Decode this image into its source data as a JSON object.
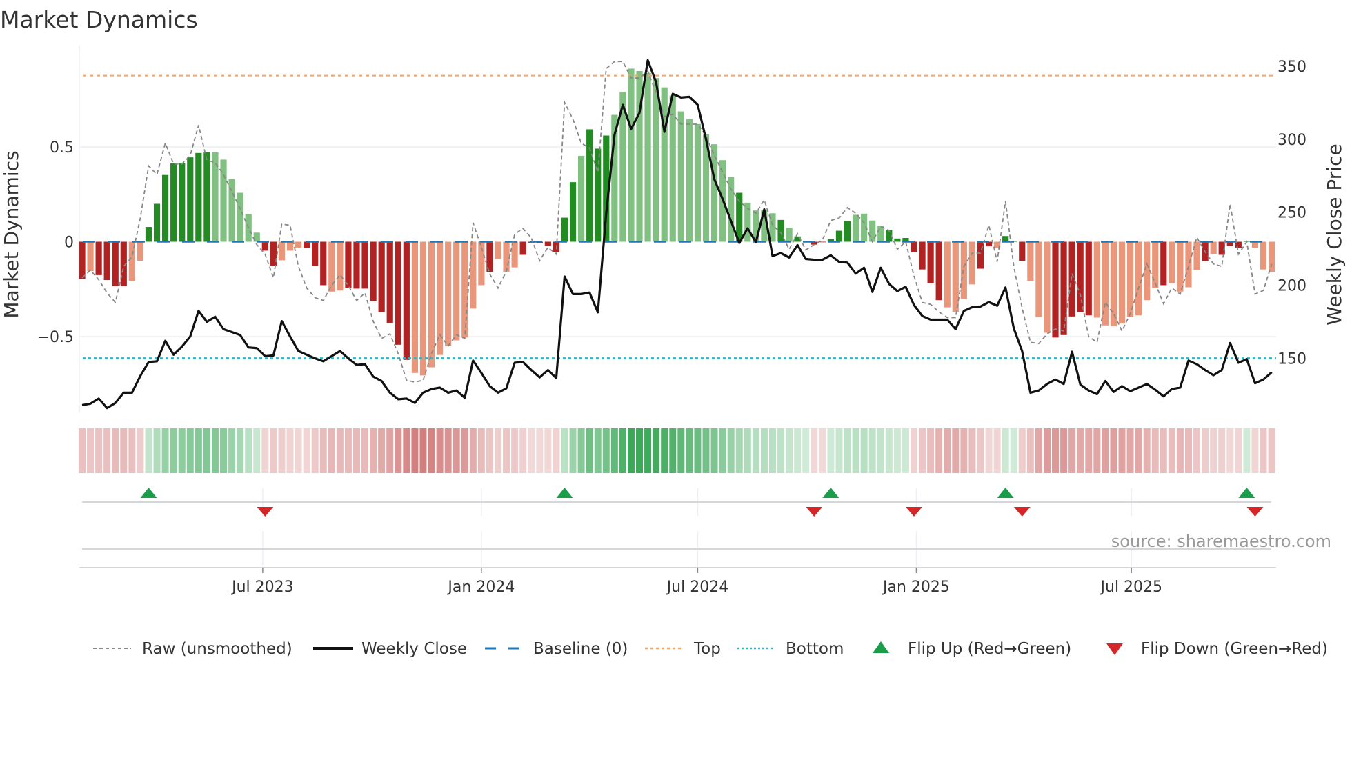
{
  "title": "Market Dynamics",
  "source": "source: sharemaestro.com",
  "chart_data": {
    "type": "bar",
    "title": "Market Dynamics",
    "frequency": "weekly",
    "start_date": "2023-01-30",
    "ylabel_left": "Market Dynamics",
    "ylabel_right": "Weekly Close Price",
    "ylim_left": [
      -0.9,
      0.98
    ],
    "ylim_right": [
      113,
      357
    ],
    "yticks_left": [
      {
        "v": 0.5,
        "label": "0.5"
      },
      {
        "v": 0,
        "label": "0"
      },
      {
        "v": -0.5,
        "label": "−0.5"
      }
    ],
    "yticks_right": [
      {
        "v": 350,
        "label": "350"
      },
      {
        "v": 300,
        "label": "300"
      },
      {
        "v": 250,
        "label": "250"
      },
      {
        "v": 200,
        "label": "200"
      },
      {
        "v": 150,
        "label": "150"
      }
    ],
    "xticks": [
      {
        "date": "2023-07-01",
        "label": "Jul 2023"
      },
      {
        "date": "2024-01-01",
        "label": "Jan 2024"
      },
      {
        "date": "2024-07-01",
        "label": "Jul 2024"
      },
      {
        "date": "2025-01-01",
        "label": "Jan 2025"
      },
      {
        "date": "2025-07-01",
        "label": "Jul 2025"
      }
    ],
    "thresholds": {
      "top": 0.876,
      "bottom": -0.614,
      "baseline": 0
    },
    "colors": {
      "green_dark": "#228b22",
      "green_light": "#80c080",
      "red_dark": "#b22222",
      "red_light": "#e9967a",
      "raw": "#888888",
      "close": "#111111",
      "baseline": "#1f77b4",
      "top": "#f4a460",
      "bottom": "#17becf",
      "flip_up": "#1a9e4a",
      "flip_down": "#d62728"
    },
    "momentum": [
      -0.196,
      -0.155,
      -0.176,
      -0.202,
      -0.234,
      -0.234,
      -0.206,
      -0.1,
      0.078,
      0.2,
      0.352,
      0.413,
      0.416,
      0.445,
      0.468,
      0.472,
      0.471,
      0.433,
      0.331,
      0.258,
      0.146,
      0.048,
      -0.047,
      -0.127,
      -0.098,
      -0.047,
      -0.032,
      -0.034,
      -0.127,
      -0.229,
      -0.263,
      -0.257,
      -0.242,
      -0.247,
      -0.247,
      -0.313,
      -0.371,
      -0.429,
      -0.543,
      -0.623,
      -0.692,
      -0.705,
      -0.662,
      -0.597,
      -0.55,
      -0.52,
      -0.505,
      -0.352,
      -0.229,
      -0.159,
      -0.092,
      -0.158,
      -0.135,
      -0.069,
      -0.005,
      -0.006,
      -0.022,
      -0.056,
      0.127,
      0.314,
      0.453,
      0.593,
      0.491,
      0.56,
      0.669,
      0.789,
      0.913,
      0.9,
      0.89,
      0.863,
      0.814,
      0.771,
      0.687,
      0.646,
      0.621,
      0.566,
      0.514,
      0.43,
      0.341,
      0.258,
      0.206,
      0.165,
      0.168,
      0.15,
      0.115,
      0.074,
      0.028,
      0.002,
      -0.015,
      -0.003,
      0.013,
      0.058,
      0.109,
      0.142,
      0.148,
      0.112,
      0.084,
      0.061,
      0.017,
      0.02,
      -0.053,
      -0.146,
      -0.219,
      -0.308,
      -0.346,
      -0.369,
      -0.302,
      -0.225,
      -0.142,
      -0.024,
      -0.032,
      0.03,
      0.003,
      -0.1,
      -0.206,
      -0.397,
      -0.48,
      -0.505,
      -0.492,
      -0.394,
      -0.371,
      -0.388,
      -0.4,
      -0.441,
      -0.445,
      -0.431,
      -0.397,
      -0.388,
      -0.308,
      -0.244,
      -0.229,
      -0.219,
      -0.263,
      -0.24,
      -0.149,
      -0.102,
      -0.064,
      -0.069,
      -0.022,
      -0.031,
      0.003,
      -0.031,
      -0.146,
      -0.159
    ],
    "shade": "dlddddlldddddddd llllllddllldddllddddddddllllllllldllldddddddldddllllllllllllllldlllldldldddddlllldddddddllllddldddllldddddlllllllldlllldldddd",
    "raw": [
      -0.19,
      -0.15,
      -0.2,
      -0.27,
      -0.32,
      -0.13,
      -0.08,
      0.125,
      0.4,
      0.354,
      0.52,
      0.41,
      0.41,
      0.455,
      0.615,
      0.43,
      0.417,
      0.354,
      0.265,
      0.175,
      0.074,
      -0.015,
      -0.066,
      -0.19,
      0.093,
      0.087,
      -0.13,
      -0.244,
      -0.295,
      -0.31,
      -0.23,
      -0.174,
      -0.23,
      -0.31,
      -0.27,
      -0.42,
      -0.51,
      -0.486,
      -0.59,
      -0.73,
      -0.74,
      -0.73,
      -0.59,
      -0.49,
      -0.55,
      -0.49,
      -0.51,
      0.1,
      -0.03,
      -0.17,
      -0.244,
      -0.155,
      0.04,
      0.07,
      0.02,
      -0.1,
      -0.03,
      -0.066,
      0.735,
      0.646,
      0.52,
      0.494,
      0.366,
      0.913,
      0.95,
      0.95,
      0.863,
      0.863,
      0.9,
      0.786,
      0.66,
      0.672,
      0.62,
      0.62,
      0.62,
      0.557,
      0.455,
      0.366,
      0.277,
      0.214,
      0.176,
      0.15,
      0.22,
      0.087,
      0.048,
      -0.04,
      0.042,
      -0.043,
      -0.015,
      0.01,
      0.112,
      0.125,
      0.18,
      0.15,
      0.1,
      0,
      0.08,
      0.06,
      -0.04,
      0,
      -0.18,
      -0.32,
      -0.33,
      -0.37,
      -0.4,
      -0.4,
      -0.13,
      -0.06,
      -0.06,
      0.087,
      -0.105,
      0.214,
      -0.13,
      -0.35,
      -0.53,
      -0.537,
      -0.486,
      -0.46,
      -0.47,
      -0.168,
      -0.28,
      -0.5,
      -0.53,
      -0.32,
      -0.38,
      -0.47,
      -0.38,
      -0.244,
      -0.117,
      -0.219,
      -0.327,
      -0.244,
      -0.276,
      -0.13,
      0.023,
      -0.053,
      -0.117,
      -0.13,
      0.2,
      -0.066,
      0,
      -0.276,
      -0.257,
      -0.117
    ],
    "close": [
      118,
      119,
      122.5,
      116,
      119.5,
      126.5,
      126.5,
      138,
      147.5,
      148,
      162,
      152.5,
      158,
      165,
      182.5,
      175,
      178.5,
      170,
      168,
      166,
      157.5,
      157,
      151.5,
      152,
      175.5,
      165,
      155,
      152.5,
      150,
      148,
      151.5,
      155,
      150,
      145.5,
      146,
      137.5,
      134.5,
      126.5,
      122,
      122.5,
      119.5,
      126.5,
      129,
      130,
      126.5,
      128,
      123,
      148.5,
      140,
      131,
      126.5,
      129.5,
      147,
      147.5,
      142,
      137,
      142,
      136.5,
      206,
      194,
      194,
      195,
      181.5,
      249,
      303,
      323.5,
      307,
      318,
      354,
      339,
      305,
      331,
      328.5,
      329,
      323.5,
      300,
      272.5,
      259,
      244,
      229,
      239,
      229.5,
      252,
      220,
      222,
      219,
      227.5,
      218,
      217.5,
      217.5,
      220.5,
      216,
      215.5,
      208,
      212,
      195.5,
      212,
      201,
      196,
      199,
      186.5,
      179,
      176.5,
      176.5,
      176.5,
      170,
      182.5,
      185,
      185.5,
      188.5,
      186,
      198.5,
      170.5,
      155,
      126.5,
      128,
      132.5,
      135.5,
      132.5,
      154.5,
      132,
      128,
      125.5,
      134.5,
      127,
      131,
      127.5,
      130,
      132.5,
      128.5,
      124,
      129,
      130,
      148.5,
      146,
      142,
      138.5,
      142,
      160.5,
      147,
      149.5,
      133,
      135.5,
      140.5
    ],
    "flips": [
      {
        "index": 9,
        "dir": "up"
      },
      {
        "index": 23,
        "dir": "down"
      },
      {
        "index": 59,
        "dir": "up"
      },
      {
        "index": 89,
        "dir": "down"
      },
      {
        "index": 91,
        "dir": "up"
      },
      {
        "index": 101,
        "dir": "down"
      },
      {
        "index": 112,
        "dir": "up"
      },
      {
        "index": 114,
        "dir": "down"
      },
      {
        "index": 141,
        "dir": "up"
      },
      {
        "index": 142,
        "dir": "down"
      }
    ],
    "legend": {
      "position": "bottom",
      "items": [
        {
          "key": "raw",
          "label": "Raw (unsmoothed)"
        },
        {
          "key": "close",
          "label": "Weekly Close"
        },
        {
          "key": "baseline",
          "label": "Baseline (0)"
        },
        {
          "key": "top",
          "label": "Top"
        },
        {
          "key": "bottom",
          "label": "Bottom"
        },
        {
          "key": "flip_up",
          "label": "Flip Up (Red→Green)"
        },
        {
          "key": "flip_down",
          "label": "Flip Down (Green→Red)"
        }
      ]
    }
  }
}
